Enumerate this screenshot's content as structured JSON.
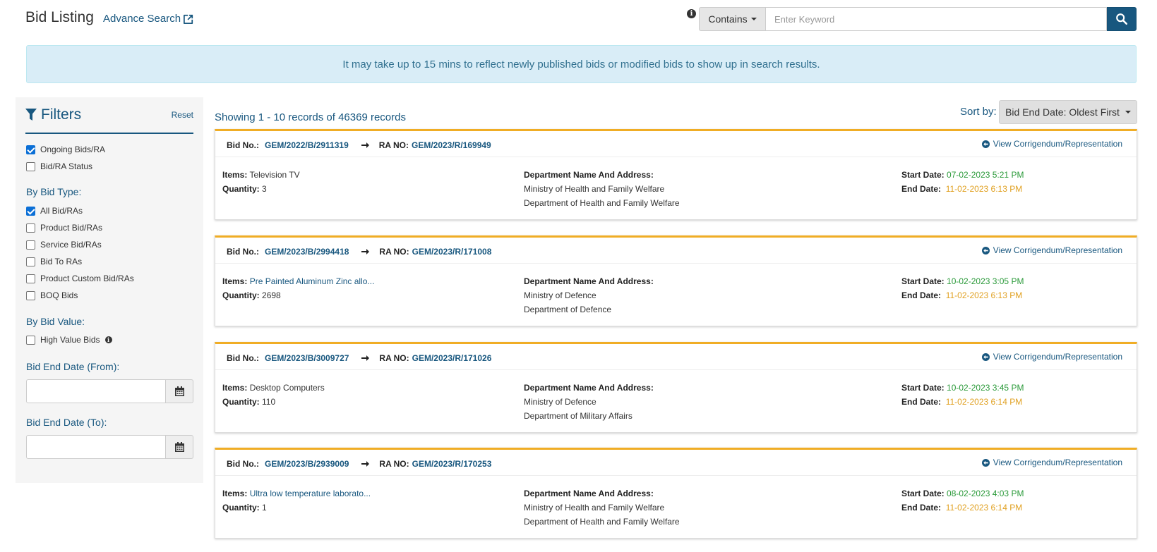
{
  "header": {
    "title": "Bid Listing",
    "advance_search": "Advance Search",
    "contains_label": "Contains",
    "search_placeholder": "Enter Keyword"
  },
  "alert": "It may take up to 15 mins to reflect newly published bids or modified bids to show up in search results.",
  "filters": {
    "title": "Filters",
    "reset": "Reset",
    "status_items": [
      {
        "label": "Ongoing Bids/RA",
        "checked": true
      },
      {
        "label": "Bid/RA Status",
        "checked": false
      }
    ],
    "bid_type_label": "By Bid Type:",
    "bid_type_items": [
      {
        "label": "All Bid/RAs",
        "checked": true
      },
      {
        "label": "Product Bid/RAs",
        "checked": false
      },
      {
        "label": "Service Bid/RAs",
        "checked": false
      },
      {
        "label": "Bid To RAs",
        "checked": false
      },
      {
        "label": "Product Custom Bid/RAs",
        "checked": false
      },
      {
        "label": "BOQ Bids",
        "checked": false
      }
    ],
    "bid_value_label": "By Bid Value:",
    "high_value": {
      "label": "High Value Bids",
      "checked": false
    },
    "end_date_from_label": "Bid End Date (From):",
    "end_date_to_label": "Bid End Date (To):"
  },
  "results": {
    "records_text": "Showing 1 - 10 records of 46369 records",
    "sort_label": "Sort by:",
    "sort_value": "Bid End Date: Oldest First",
    "labels": {
      "bid_no": "Bid No.:",
      "ra_no": "RA NO:",
      "corrigendum": "View Corrigendum/Representation",
      "items": "Items:",
      "quantity": "Quantity:",
      "department": "Department Name And Address:",
      "start_date": "Start Date:",
      "end_date": "End Date:"
    },
    "bids": [
      {
        "bid_no": "GEM/2022/B/2911319",
        "ra_no": "GEM/2023/R/169949",
        "items": "Television TV",
        "items_link": false,
        "quantity": "3",
        "ministry": "Ministry of Health and Family Welfare",
        "department": "Department of Health and Family Welfare",
        "start_date": "07-02-2023 5:21 PM",
        "end_date": "11-02-2023 6:13 PM"
      },
      {
        "bid_no": "GEM/2023/B/2994418",
        "ra_no": "GEM/2023/R/171008",
        "items": "Pre Painted Aluminum Zinc allo...",
        "items_link": true,
        "quantity": "2698",
        "ministry": "Ministry of Defence",
        "department": "Department of Defence",
        "start_date": "10-02-2023 3:05 PM",
        "end_date": "11-02-2023 6:13 PM"
      },
      {
        "bid_no": "GEM/2023/B/3009727",
        "ra_no": "GEM/2023/R/171026",
        "items": "Desktop Computers",
        "items_link": false,
        "quantity": "110",
        "ministry": "Ministry of Defence",
        "department": "Department of Military Affairs",
        "start_date": "10-02-2023 3:45 PM",
        "end_date": "11-02-2023 6:14 PM"
      },
      {
        "bid_no": "GEM/2023/B/2939009",
        "ra_no": "GEM/2023/R/170253",
        "items": "Ultra low temperature laborato...",
        "items_link": true,
        "quantity": "1",
        "ministry": "Ministry of Health and Family Welfare",
        "department": "Department of Health and Family Welfare",
        "start_date": "08-02-2023 4:03 PM",
        "end_date": "11-02-2023 6:14 PM"
      }
    ]
  },
  "colors": {
    "primary": "#18577f",
    "accent_border": "#f0ad25",
    "start_date": "#2b9a3a",
    "end_date": "#e0a020",
    "alert_bg": "#d9edf7"
  }
}
